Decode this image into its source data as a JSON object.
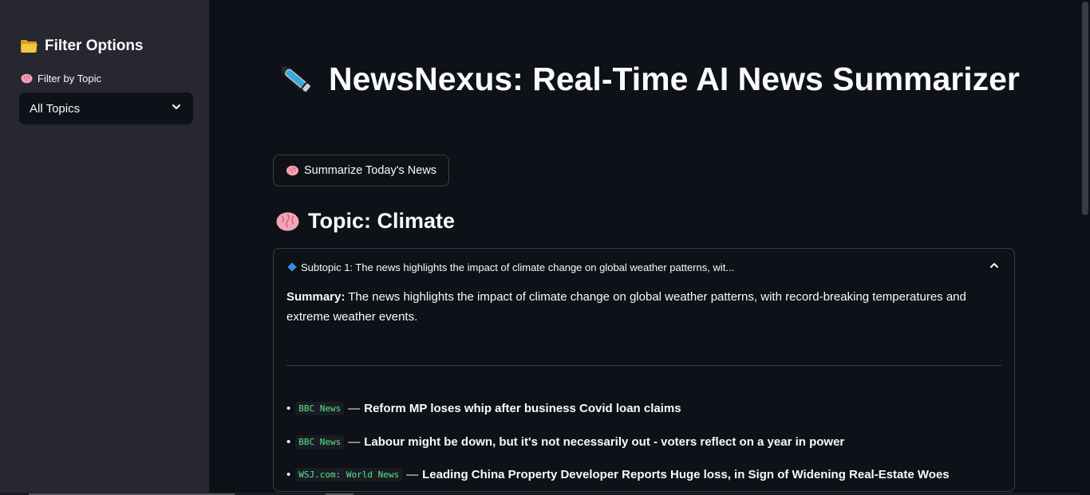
{
  "sidebar": {
    "heading": "Filter Options",
    "heading_icon": "folder-icon",
    "filter_label": "Filter by Topic",
    "filter_icon": "brain-icon",
    "select_value": "All Topics"
  },
  "main": {
    "title": "NewsNexus: Real-Time AI News Summarizer",
    "title_icon": "pen-icon",
    "summarize_button": "Summarize Today's News",
    "topic_heading": "Topic: Climate",
    "expander": {
      "title": "Subtopic 1: The news highlights the impact of climate change on global weather patterns, wit...",
      "summary_label": "Summary:",
      "summary_text": "The news highlights the impact of climate change on global weather patterns, with record-breaking temperatures and extreme weather events.",
      "news": [
        {
          "source": "BBC News",
          "headline": "Reform MP loses whip after business Covid loan claims"
        },
        {
          "source": "BBC News",
          "headline": "Labour might be down, but it's not necessarily out - voters reflect on a year in power"
        },
        {
          "source": "WSJ.com: World News",
          "headline": "Leading China Property Developer Reports Huge loss, in Sign of Widening Real-Estate Woes"
        }
      ]
    }
  },
  "colors": {
    "background": "#0e1117",
    "sidebar": "#262730",
    "source_code": "#5ce488",
    "accent_diamond": "#3a8dde"
  }
}
